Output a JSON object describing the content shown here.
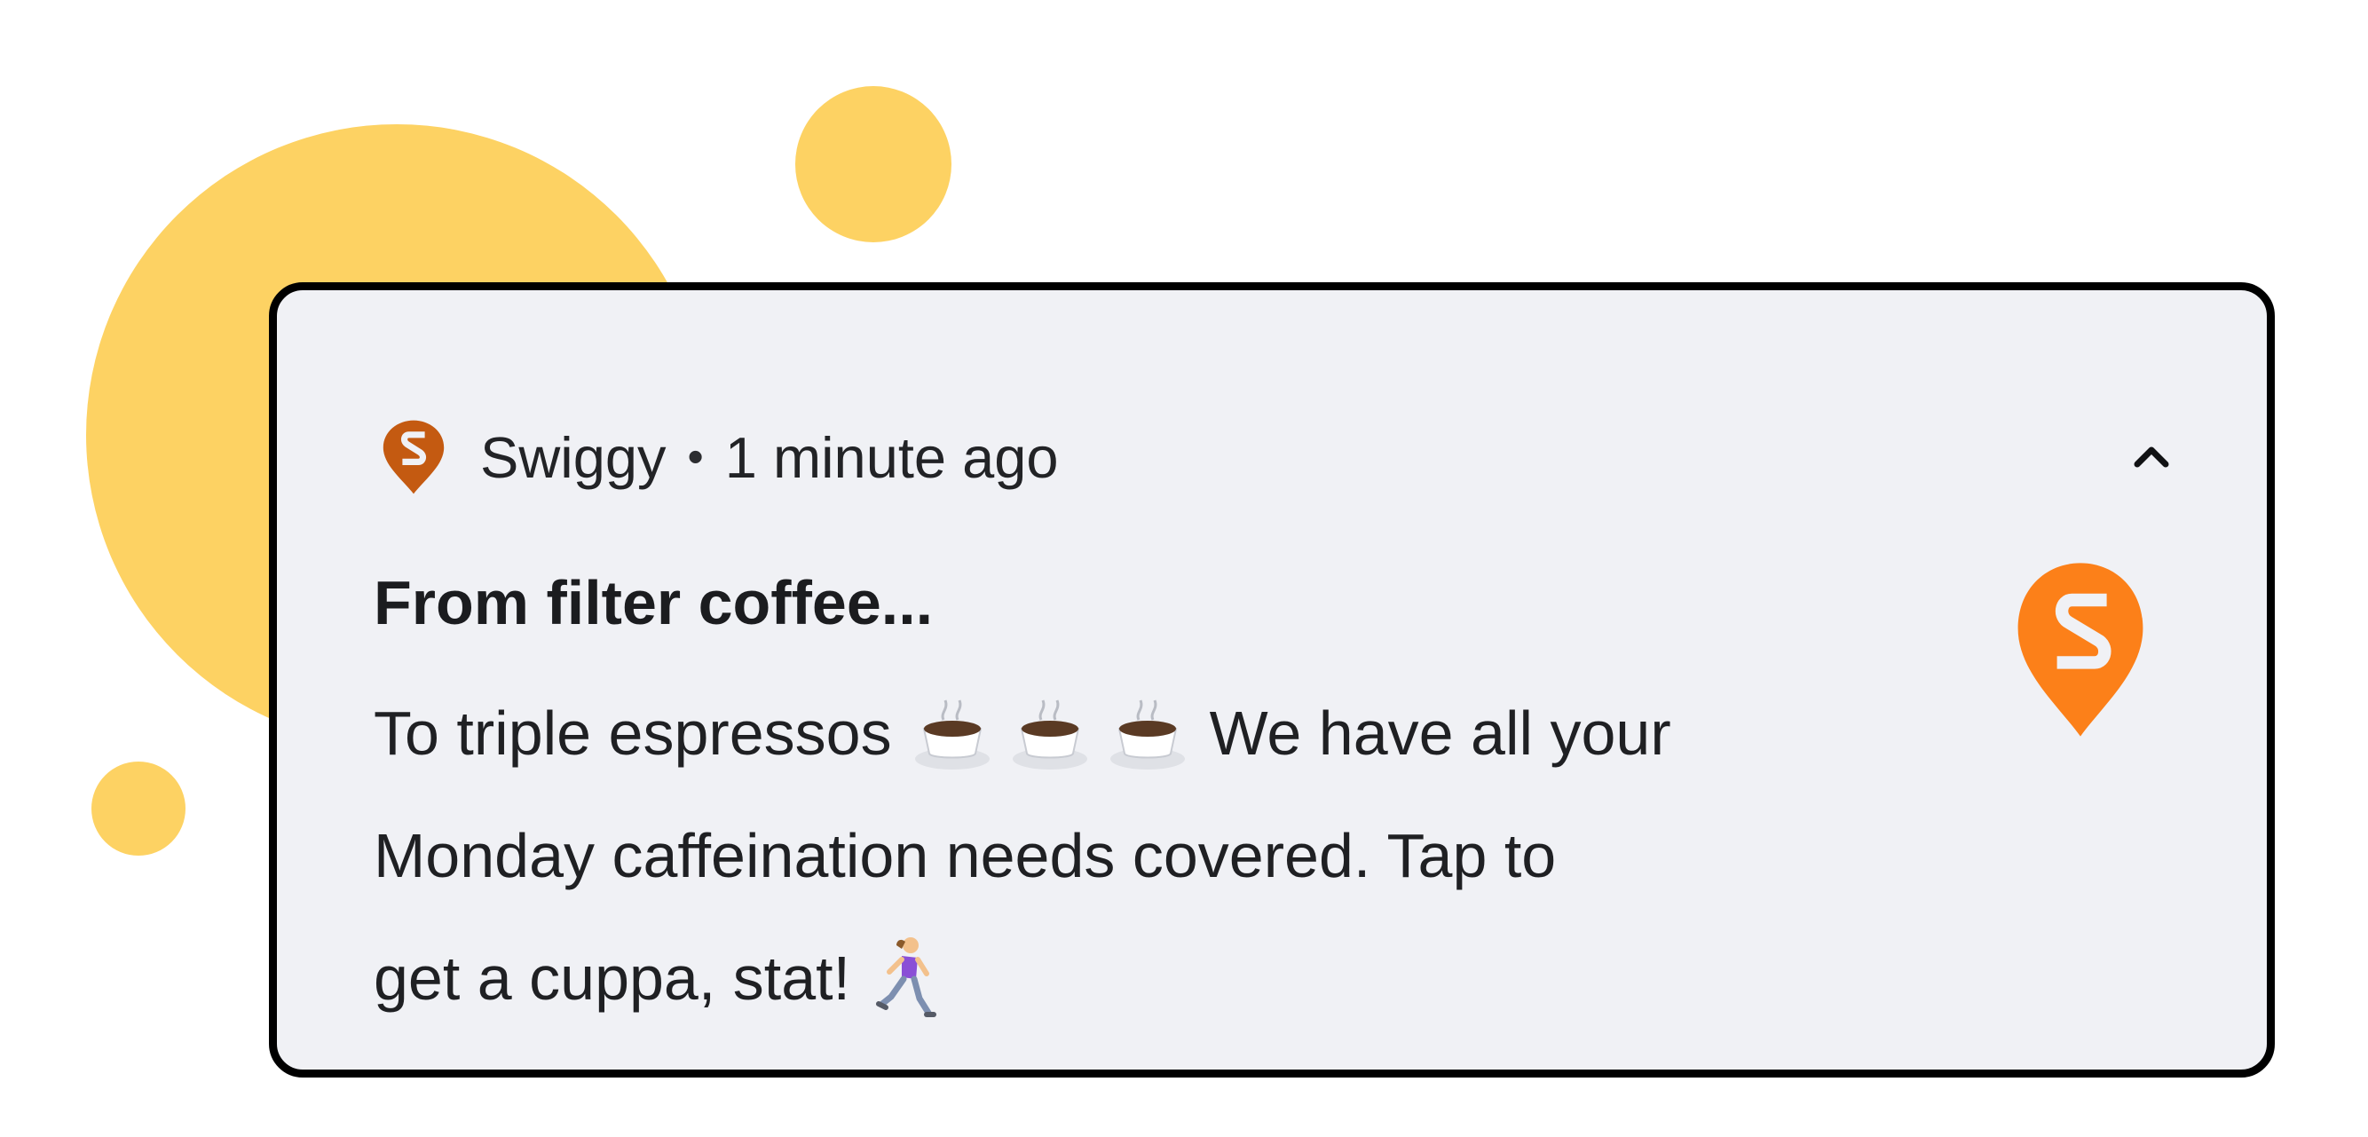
{
  "colors": {
    "decor_circle": "#fdd263",
    "card_background": "#f0f1f5",
    "card_border": "#000000",
    "swiggy_orange": "#fc8019",
    "swiggy_dark_orange": "#c45a11"
  },
  "decorations": {
    "circles": [
      "large-circle",
      "top-circle",
      "small-circle"
    ]
  },
  "notification": {
    "app_name": "Swiggy",
    "separator": "•",
    "time": "1 minute ago",
    "title": "From filter coffee...",
    "body_line1_before": "To triple espressos",
    "body_line1_after": "We have all your",
    "body_line2": "Monday caffeination needs covered. Tap to",
    "body_line3": "get a cuppa, stat!",
    "icons": {
      "small_app": "swiggy-logo-icon",
      "large_app": "swiggy-logo-icon",
      "collapse": "chevron-up-icon",
      "coffee": "coffee-cup-icon",
      "runner": "woman-running-icon"
    }
  }
}
